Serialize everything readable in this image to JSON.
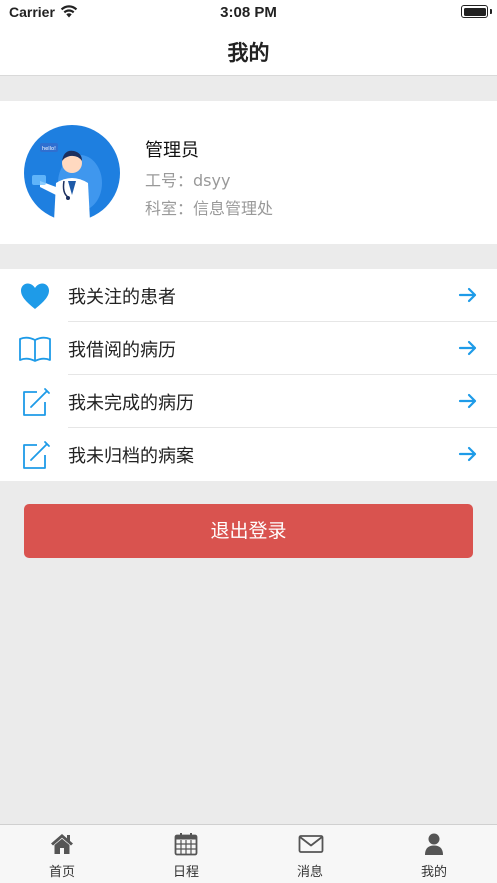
{
  "status_bar": {
    "carrier": "Carrier",
    "time": "3:08 PM"
  },
  "nav": {
    "title": "我的"
  },
  "profile": {
    "name": "管理员",
    "id_label": "工号：",
    "id_value": "dsyy",
    "dept_label": "科室：",
    "dept_value": "信息管理处",
    "avatar_badge": "hello!"
  },
  "menu": {
    "items": [
      {
        "label": "我关注的患者",
        "icon": "heart-icon"
      },
      {
        "label": "我借阅的病历",
        "icon": "book-icon"
      },
      {
        "label": "我未完成的病历",
        "icon": "edit-icon"
      },
      {
        "label": "我未归档的病案",
        "icon": "edit-icon"
      }
    ]
  },
  "logout": {
    "label": "退出登录"
  },
  "tabs": [
    {
      "label": "首页",
      "icon": "home-icon"
    },
    {
      "label": "日程",
      "icon": "calendar-icon"
    },
    {
      "label": "消息",
      "icon": "envelope-icon"
    },
    {
      "label": "我的",
      "icon": "user-icon"
    }
  ],
  "colors": {
    "accent": "#1e9be8",
    "logout": "#d9534f",
    "background": "#ebebeb",
    "secondary_text": "#999999"
  }
}
